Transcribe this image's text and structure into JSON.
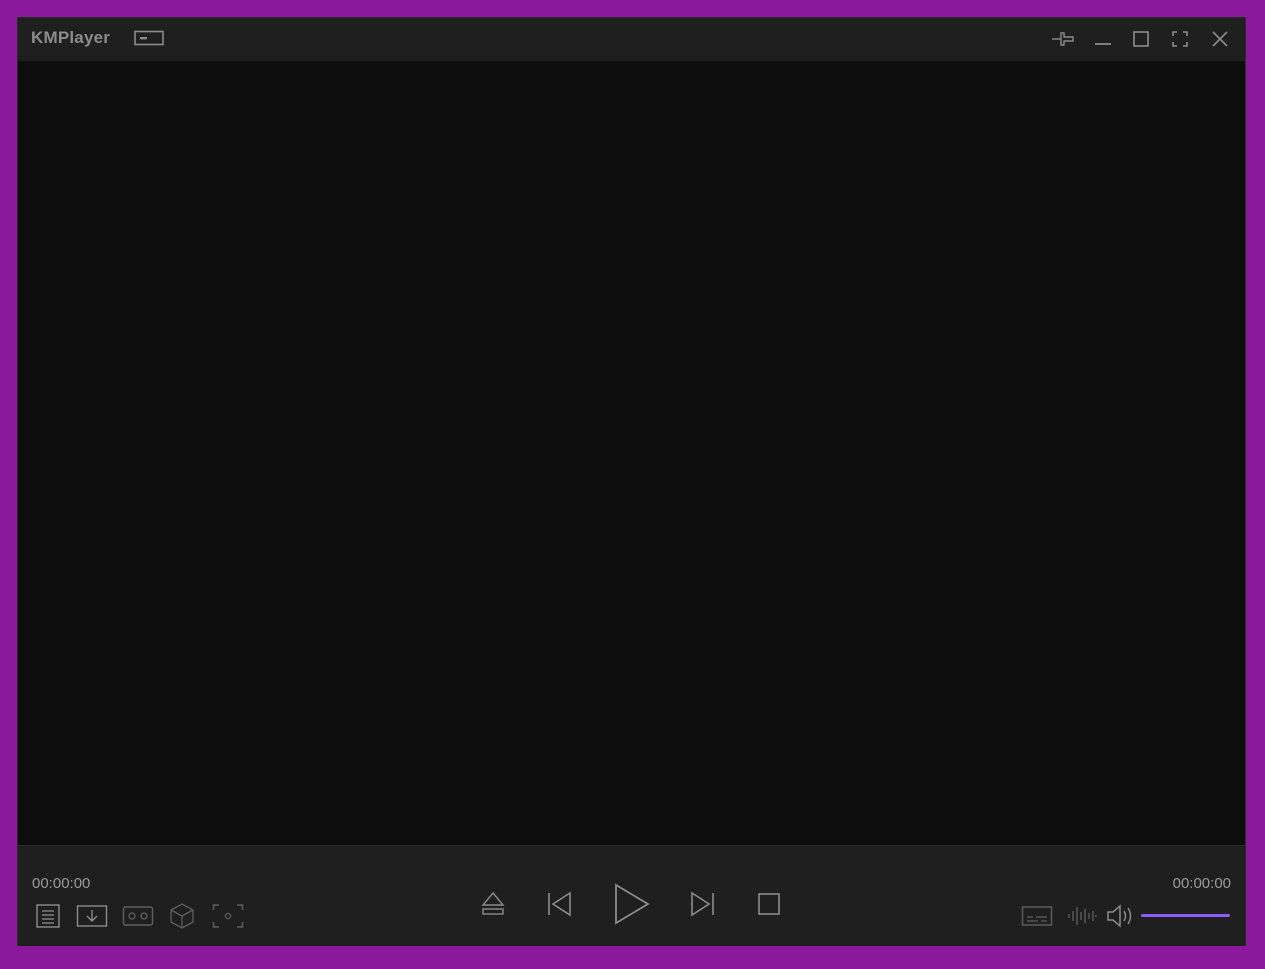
{
  "window": {
    "title": "KMPlayer"
  },
  "titlebar": {
    "buttons": [
      "pin-icon",
      "minimize-icon",
      "maximize-icon",
      "fullscreen-icon",
      "close-icon"
    ]
  },
  "playback": {
    "current_time": "00:00:00",
    "total_time": "00:00:00",
    "volume_fraction": 1.0
  },
  "left_tools": [
    "playlist-icon",
    "download-icon",
    "vr-glasses-icon",
    "3d-cube-icon",
    "capture-icon"
  ],
  "center_controls": [
    "eject-icon",
    "previous-icon",
    "play-icon",
    "next-icon",
    "stop-icon"
  ],
  "right_tools": [
    "subtitle-icon",
    "audio-waveform-icon",
    "speaker-icon"
  ],
  "colors": {
    "frame": "#8a1a9b",
    "titlebar": "#1f1f1f",
    "video": "#0e0e0e",
    "icon": "#8c8c8c",
    "volume_accent": "#8b5cf6"
  }
}
